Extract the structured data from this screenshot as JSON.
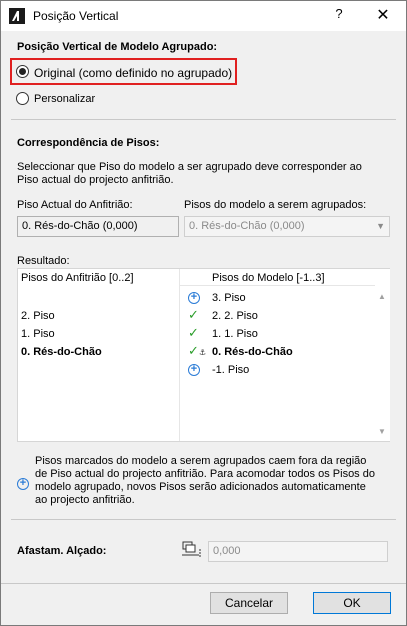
{
  "window": {
    "title": "Posição Vertical",
    "help": "?",
    "close": "✕"
  },
  "group1": {
    "heading": "Posição Vertical de Modelo Agrupado:",
    "option_original": "Original (como definido no agrupado)",
    "option_custom": "Personalizar",
    "selected": "original"
  },
  "group2": {
    "heading": "Correspondência de Pisos:",
    "description_line1": "Seleccionar que Piso do modelo a ser agrupado deve corresponder ao",
    "description_line2": "Piso actual do projecto anfitrião.",
    "host_label": "Piso Actual do Anfitrião:",
    "host_value": "0. Rés-do-Chão (0,000)",
    "model_label": "Pisos do modelo a serem agrupados:",
    "model_value": "0. Rés-do-Chão (0,000)"
  },
  "results": {
    "label": "Resultado:",
    "host_header": "Pisos do Anfitrião [0..2]",
    "model_header": "Pisos do Modelo [-1..3]",
    "host_rows": [
      "",
      "2. Piso",
      "1. Piso",
      "0. Rés-do-Chão",
      ""
    ],
    "model_rows": [
      "3. Piso",
      "2. 2. Piso",
      "1. 1. Piso",
      "0. Rés-do-Chão",
      "-1. Piso"
    ],
    "row_icons": [
      "plus",
      "check",
      "check",
      "check-anchor",
      "plus"
    ]
  },
  "info": {
    "line1": "Pisos marcados do modelo a serem agrupados caem fora da região",
    "line2": "de Piso actual do projecto anfitrião. Para acomodar todos os Pisos do",
    "line3": "modelo agrupado, novos Pisos serão adicionados automaticamente",
    "line4": "ao projecto anfitrião."
  },
  "offset": {
    "label": "Afastam. Alçado:",
    "value": "0,000"
  },
  "buttons": {
    "cancel": "Cancelar",
    "ok": "OK"
  },
  "colors": {
    "highlight": "#e02020",
    "plus": "#2a7bd6",
    "check": "#2a9d2a",
    "ok_border": "#0078d7"
  }
}
